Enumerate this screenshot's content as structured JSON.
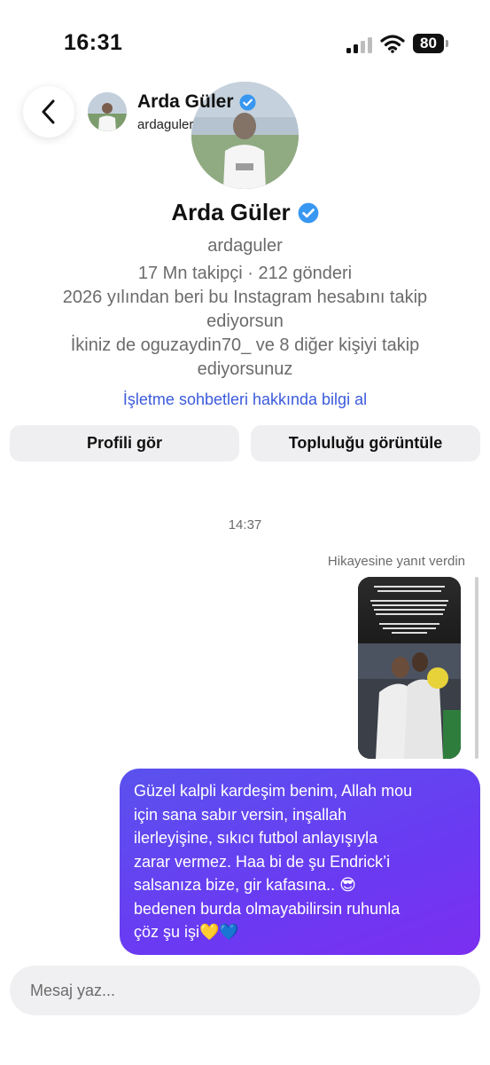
{
  "status_bar": {
    "time": "16:31",
    "battery": "80"
  },
  "header": {
    "name": "Arda Güler",
    "username": "ardaguler"
  },
  "profile": {
    "name": "Arda Güler",
    "username": "ardaguler",
    "stats": "17 Mn takipçi · 212 gönderi",
    "following_since_line1": "2026 yılından beri bu Instagram hesabını takip",
    "following_since_line2": "ediyorsun",
    "mutual_line1": "İkiniz de oguzaydin70_ ve 8 diğer kişiyi takip",
    "mutual_line2": "ediyorsunuz",
    "info_link": "İşletme sohbetleri hakkında bilgi al"
  },
  "buttons": {
    "view_profile": "Profili gör",
    "view_community": "Topluluğu görüntüle"
  },
  "chat": {
    "timestamp": "14:37",
    "reply_label": "Hikayesine yanıt verdin",
    "message_lines": [
      "Güzel kalpli kardeşim benim, Allah mou",
      "için sana sabır versin, inşallah",
      "ilerleyişine, sıkıcı futbol anlayışıyla",
      "zarar vermez. Haa bi de şu Endrick’i",
      "salsanıza bize, gir kafasına.. 😎",
      "bedenen burda olmayabilirsin ruhunla",
      "çöz şu işi💛💙"
    ]
  },
  "composer": {
    "placeholder": "Mesaj yaz..."
  },
  "colors": {
    "accent": "#3b5bdb",
    "bubble": "#6a3af2",
    "verified": "#3897f0"
  }
}
